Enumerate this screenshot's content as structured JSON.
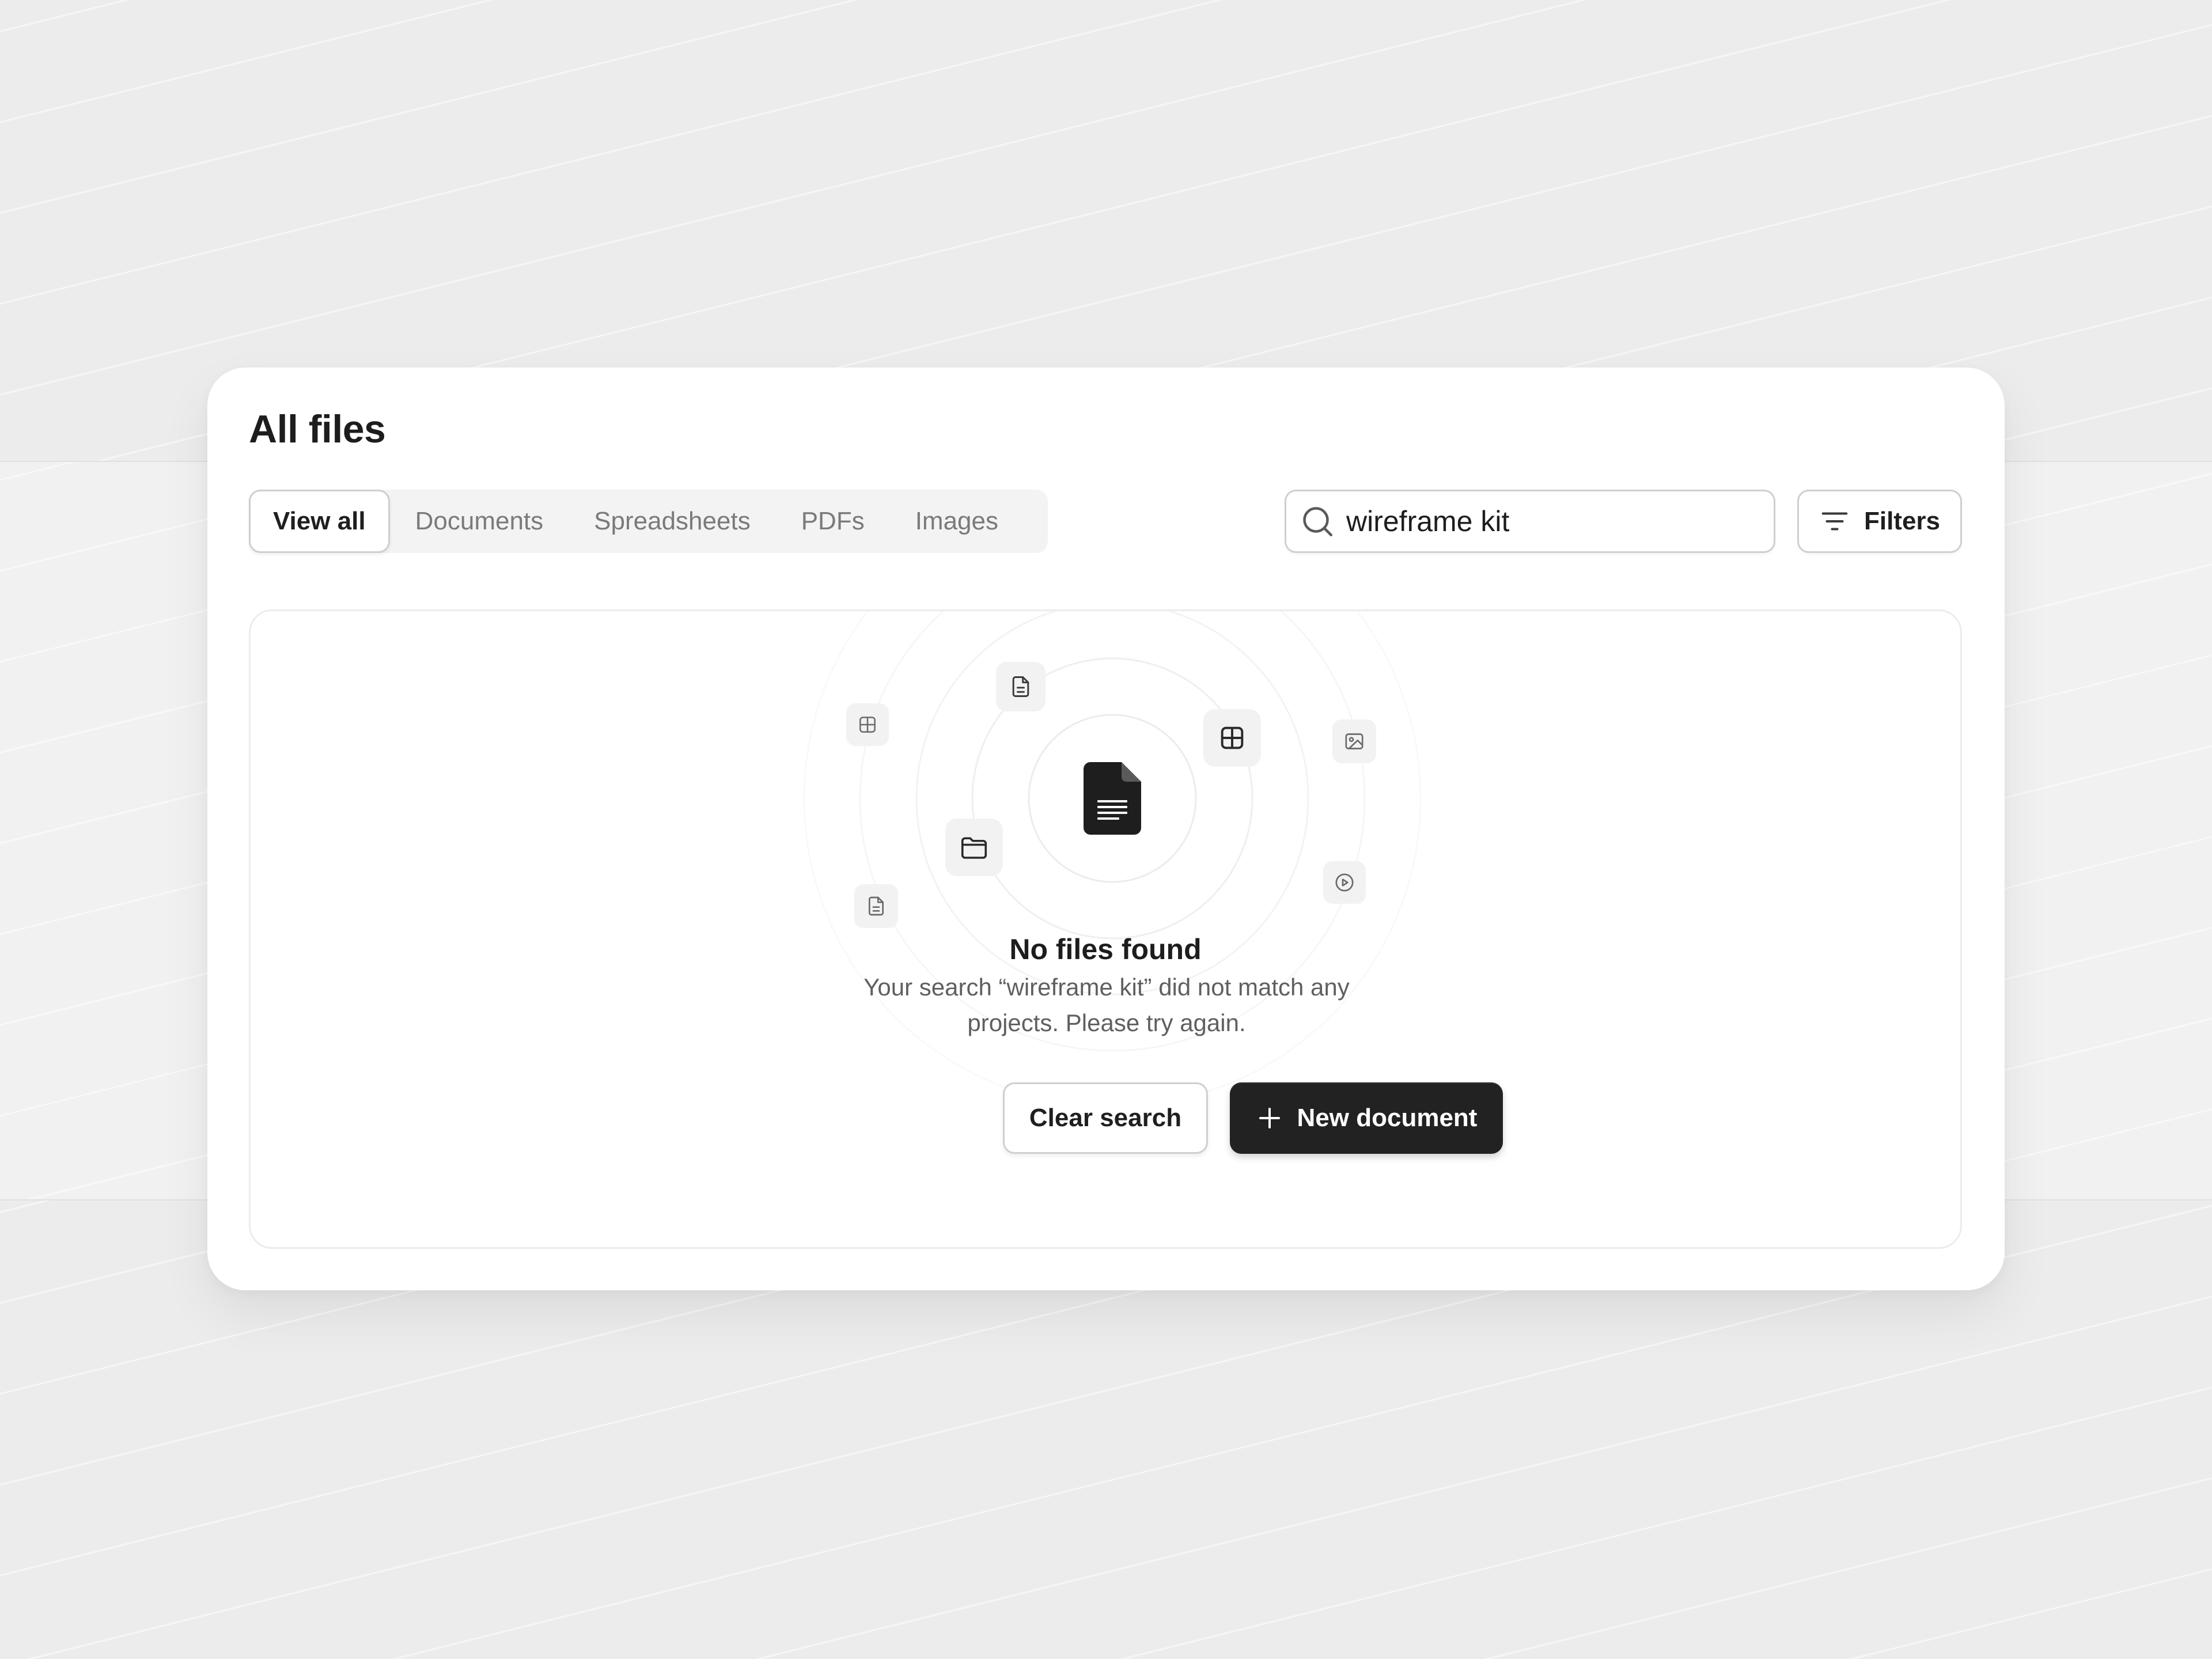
{
  "header": {
    "title": "All files"
  },
  "tabs": [
    {
      "label": "View all",
      "active": true
    },
    {
      "label": "Documents",
      "active": false
    },
    {
      "label": "Spreadsheets",
      "active": false
    },
    {
      "label": "PDFs",
      "active": false
    },
    {
      "label": "Images",
      "active": false
    }
  ],
  "search": {
    "value": "wireframe kit",
    "placeholder": "",
    "icon": "search-icon"
  },
  "filters": {
    "label": "Filters",
    "icon": "filter-lines-icon"
  },
  "empty_state": {
    "illustration_icons": [
      "file-text-icon",
      "grid-icon",
      "image-icon",
      "folder-icon",
      "play-circle-icon",
      "document-icon"
    ],
    "title": "No files found",
    "description": "Your search “wireframe kit” did not match any projects. Please try again.",
    "clear_label": "Clear search",
    "new_label": "New document"
  },
  "colors": {
    "primary_button": "#222222",
    "border": "#cfcfcf",
    "text_primary": "#1d1d1d",
    "text_muted": "#7a7a7a"
  }
}
